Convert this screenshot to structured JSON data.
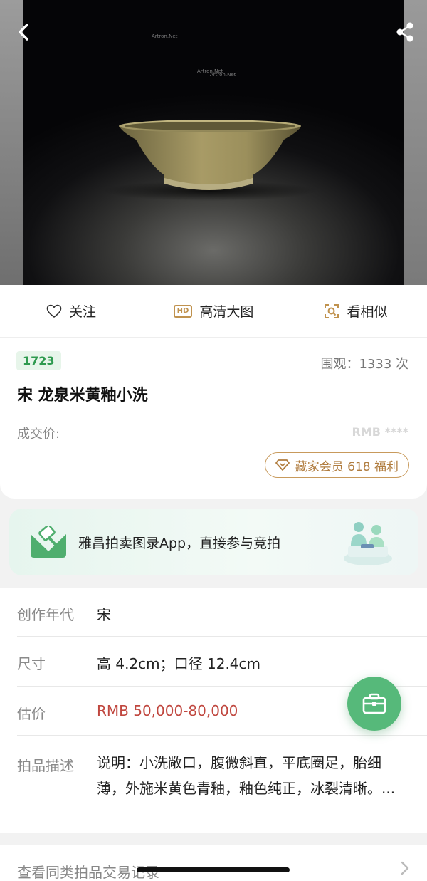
{
  "hero": {
    "watermarks": [
      "Artron.Net",
      "Artron.Net",
      "Artron.Net"
    ],
    "back_icon": "chevron-left-icon",
    "share_icon": "share-icon"
  },
  "actions": [
    {
      "label": "关注",
      "icon": "heart-icon"
    },
    {
      "label": "高清大图",
      "icon": "hd-icon",
      "badge": "HD"
    },
    {
      "label": "看相似",
      "icon": "scan-similar-icon"
    }
  ],
  "lot": {
    "number": "1723",
    "views": "围观：1333 次",
    "title": "宋 龙泉米黄釉小洗",
    "price_label": "成交价:",
    "price_value": "RMB ****",
    "vip_label": "藏家会员 618 福利"
  },
  "banner": {
    "text": "雅昌拍卖图录App，直接参与竞拍"
  },
  "details": {
    "era_label": "创作年代",
    "era_value": "宋",
    "size_label": "尺寸",
    "size_value": "高 4.2cm；口径 12.4cm",
    "estimate_label": "估价",
    "estimate_value": "RMB  50,000-80,000",
    "desc_label": "拍品描述",
    "desc_value": "说明：小洗敞口，腹微斜直，平底圈足，胎细薄，外施米黄色青釉，釉色纯正，冰裂清晰。..."
  },
  "more": {
    "label": "查看同类拍品交易记录"
  },
  "colors": {
    "accent_green": "#56b97a",
    "gold": "#c0924e",
    "estimate_red": "#c0473f"
  }
}
